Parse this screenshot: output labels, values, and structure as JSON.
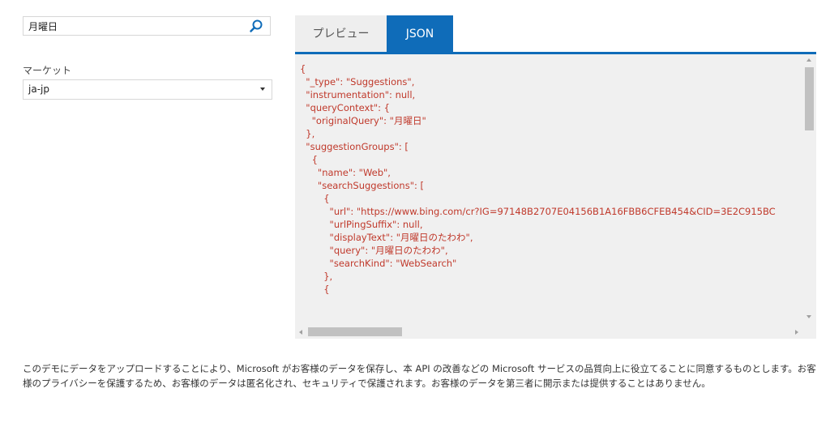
{
  "search": {
    "value": "月曜日"
  },
  "market": {
    "label": "マーケット",
    "value": "ja-jp"
  },
  "tabs": {
    "preview": "プレビュー",
    "json": "JSON"
  },
  "json_text": "{\n  \"_type\": \"Suggestions\",\n  \"instrumentation\": null,\n  \"queryContext\": {\n    \"originalQuery\": \"月曜日\"\n  },\n  \"suggestionGroups\": [\n    {\n      \"name\": \"Web\",\n      \"searchSuggestions\": [\n        {\n          \"url\": \"https://www.bing.com/cr?IG=97148B2707E04156B1A16FBB6CFEB454&CID=3E2C915BC\n          \"urlPingSuffix\": null,\n          \"displayText\": \"月曜日のたわわ\",\n          \"query\": \"月曜日のたわわ\",\n          \"searchKind\": \"WebSearch\"\n        },\n        {",
  "disclaimer": "このデモにデータをアップロードすることにより、Microsoft がお客様のデータを保存し、本 API の改善などの Microsoft サービスの品質向上に役立てることに同意するものとします。お客様のプライバシーを保護するため、お客様のデータは匿名化され、セキュリティで保護されます。お客様のデータを第三者に開示または提供することはありません。",
  "colors": {
    "accent": "#0f6cb9",
    "json_text": "#c0392b",
    "panel_bg": "#f0f0f0",
    "tab_inactive": "#eeeeee"
  },
  "icons": {
    "search": "search-icon",
    "dropdown": "chevron-down-icon"
  }
}
